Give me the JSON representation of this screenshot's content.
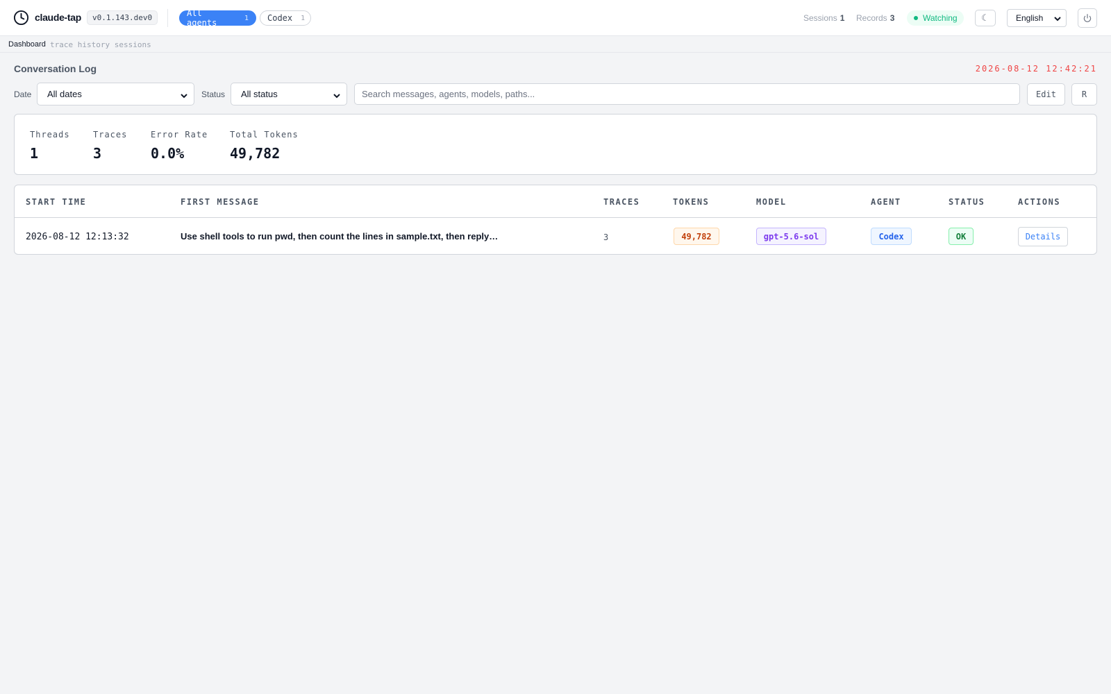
{
  "app": {
    "title": "claude-tap",
    "version": "v0.1.143.dev0",
    "logo_icon": "clock-icon"
  },
  "agent_tabs": [
    {
      "label": "All agents",
      "count": "1",
      "active": true
    },
    {
      "label": "Codex",
      "count": "1",
      "active": false
    }
  ],
  "header_stats": {
    "sessions_label": "Sessions",
    "sessions_value": "1",
    "records_label": "Records",
    "records_value": "3",
    "watching_label": "Watching"
  },
  "theme_toggle_icon": "☾",
  "language": {
    "selected": "English"
  },
  "power_icon": "power-icon",
  "breadcrumb": {
    "main": "Dashboard",
    "sub": "trace history sessions"
  },
  "page": {
    "title": "Conversation Log",
    "clock": "2026-08-12 12:42:21"
  },
  "filters": {
    "date_label": "Date",
    "date_selected": "All dates",
    "status_label": "Status",
    "status_selected": "All status",
    "search_placeholder": "Search messages, agents, models, paths...",
    "search_value": "",
    "edit_label": "Edit",
    "r_label": "R"
  },
  "summary": [
    {
      "label": "Threads",
      "value": "1"
    },
    {
      "label": "Traces",
      "value": "3"
    },
    {
      "label": "Error Rate",
      "value": "0.0%"
    },
    {
      "label": "Total Tokens",
      "value": "49,782"
    }
  ],
  "table": {
    "columns": [
      "START TIME",
      "FIRST MESSAGE",
      "TRACES",
      "TOKENS",
      "MODEL",
      "AGENT",
      "STATUS",
      "ACTIONS"
    ],
    "rows": [
      {
        "start_time": "2026-08-12 12:13:32",
        "first_message": "Use shell tools to run pwd, then count the lines in sample.txt, then reply…",
        "traces": "3",
        "tokens": "49,782",
        "model": "gpt-5.6-sol",
        "agent": "Codex",
        "status": "OK",
        "action": "Details"
      }
    ]
  },
  "colors": {
    "accent": "#3b82f6",
    "watching": "#10b981",
    "clock": "#ef4444",
    "tokens": "#c2410c",
    "model": "#7c3aed",
    "agent": "#2563eb",
    "status_ok": "#15803d"
  }
}
